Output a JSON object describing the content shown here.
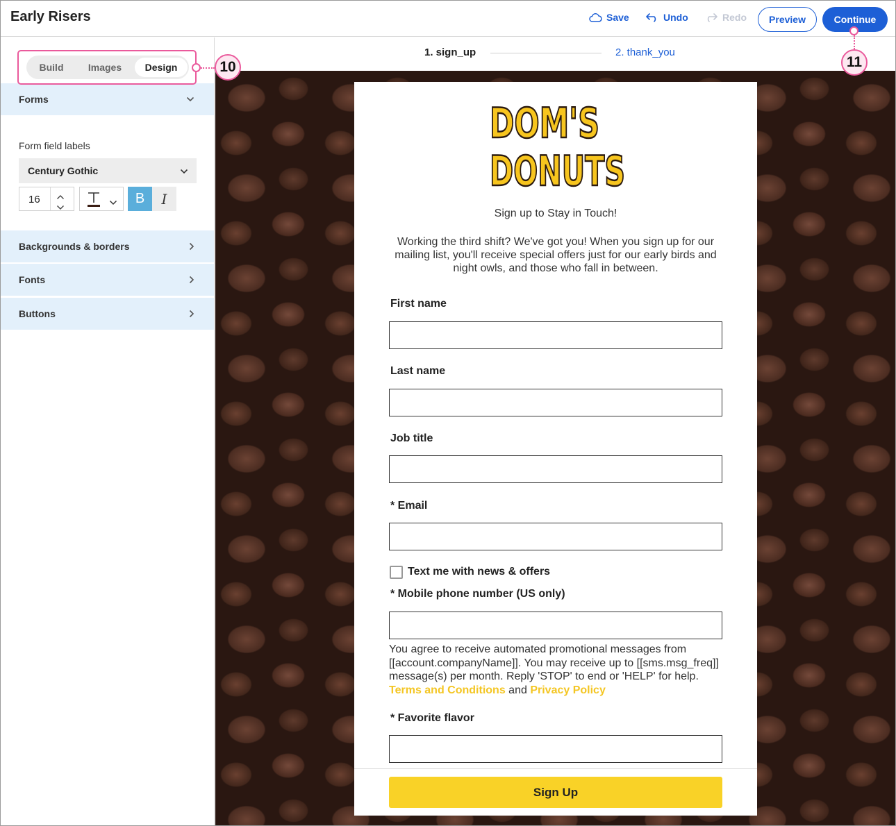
{
  "app": {
    "title": "Early Risers"
  },
  "toolbar": {
    "save_label": "Save",
    "undo_label": "Undo",
    "redo_label": "Redo",
    "preview_label": "Preview",
    "continue_label": "Continue"
  },
  "sidebar": {
    "tabs": [
      {
        "label": "Build",
        "active": false
      },
      {
        "label": "Images",
        "active": false
      },
      {
        "label": "Design",
        "active": true
      }
    ],
    "sections": {
      "forms": "Forms",
      "backgrounds": "Backgrounds & borders",
      "fonts": "Fonts",
      "buttons": "Buttons"
    },
    "form_field_labels": {
      "title": "Form field labels",
      "font": "Century Gothic",
      "size": "16",
      "bold_label": "B",
      "italic_label": "I",
      "bold_active": true
    }
  },
  "steps": [
    {
      "label": "1.  sign_up",
      "active": true
    },
    {
      "label": "2.  thank_you",
      "active": false
    }
  ],
  "callouts": {
    "tabs": "10",
    "continue": "11"
  },
  "form": {
    "logo_lines": [
      "DOM'S",
      "DONUTS"
    ],
    "heading": "Sign up to Stay in Touch!",
    "intro": "Working the third shift? We've got you! When you sign up for our mailing list, you'll receive special offers just for our early birds and night owls, and those who fall in between.",
    "fields": {
      "first_name": "First name",
      "last_name": "Last name",
      "job_title": "Job title",
      "email": "* Email",
      "sms_opt_in": "Text me with news & offers",
      "mobile": "* Mobile phone number (US only)",
      "flavor": "* Favorite flavor"
    },
    "consent_text": "You agree to receive automated promotional messages from [[account.companyName]]. You may receive up to [[sms.msg_freq]] message(s) per month. Reply 'STOP' to end or 'HELP' for help.",
    "terms_link": "Terms and Conditions",
    "and_text": "and",
    "privacy_link": "Privacy Policy",
    "submit_label": "Sign Up"
  },
  "colors": {
    "accent_blue": "#1d5fd6",
    "callout_pink": "#ea5a9c",
    "brand_yellow": "#f9d227",
    "sidebar_section_bg": "#e3f0fb"
  }
}
